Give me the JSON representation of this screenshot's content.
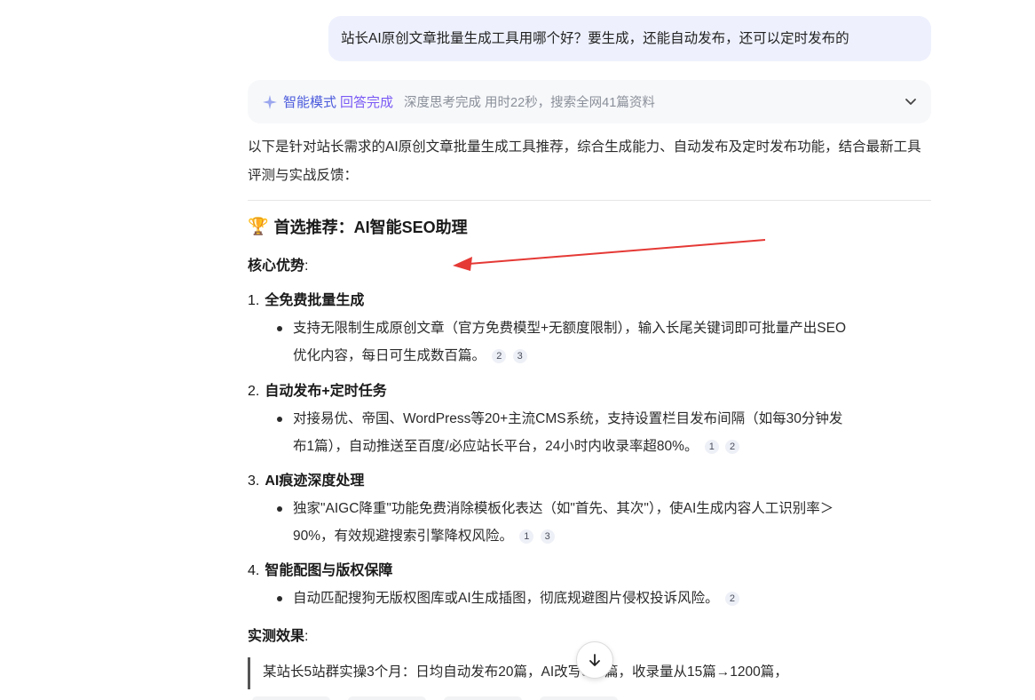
{
  "user_message": "站长AI原创文章批量生成工具用哪个好？要生成，还能自动发布，还可以定时发布的",
  "status": {
    "mode": "智能模式",
    "done": "回答完成",
    "detail": "深度思考完成 用时22秒，搜索全网41篇资料"
  },
  "intro": "以下是针对站长需求的AI原创文章批量生成工具推荐，综合生成能力、自动发布及定时发布功能，结合最新工具评测与实战反馈：",
  "heading": {
    "icon": "🏆",
    "text": "首选推荐：AI智能SEO助理"
  },
  "core_label": "核心优势",
  "colon": ":",
  "items": [
    {
      "num": "1.",
      "title": "全免费批量生成",
      "bullet_l1": "支持无限制生成原创文章（官方免费模型+无额度限制），输入长尾关键词即可批量产出SEO",
      "bullet_l2": "优化内容，每日可生成数百篇。",
      "cites": [
        "2",
        "3"
      ]
    },
    {
      "num": "2.",
      "title": "自动发布+定时任务",
      "bullet_l1": "对接易优、帝国、WordPress等20+主流CMS系统，支持设置栏目发布间隔（如每30分钟发",
      "bullet_l2": "布1篇），自动推送至百度/必应站长平台，24小时内收录率超80%。",
      "cites": [
        "1",
        "2"
      ]
    },
    {
      "num": "3.",
      "title": "AI痕迹深度处理",
      "bullet_l1": "独家\"AIGC降重\"功能免费消除模板化表达（如\"首先、其次\"），使AI生成内容人工识别率＞",
      "bullet_l2": "90%，有效规避搜索引擎降权风险。",
      "cites": [
        "1",
        "3"
      ]
    },
    {
      "num": "4.",
      "title": "智能配图与版权保障",
      "bullet_l1": "自动匹配搜狗无版权图库或AI生成插图，彻底规避图片侵权投诉风险。",
      "cites": [
        "2"
      ]
    }
  ],
  "test_label": "实测效果",
  "quote": "某站长5站群实操3个月：日均自动发布20篇，AI改写800篇，收录量从15篇→1200篇，",
  "colors": {
    "accent": "#4b5bdc",
    "done": "#7a5af5",
    "bubble": "#eef1fd",
    "annotation_arrow": "#e53935"
  }
}
